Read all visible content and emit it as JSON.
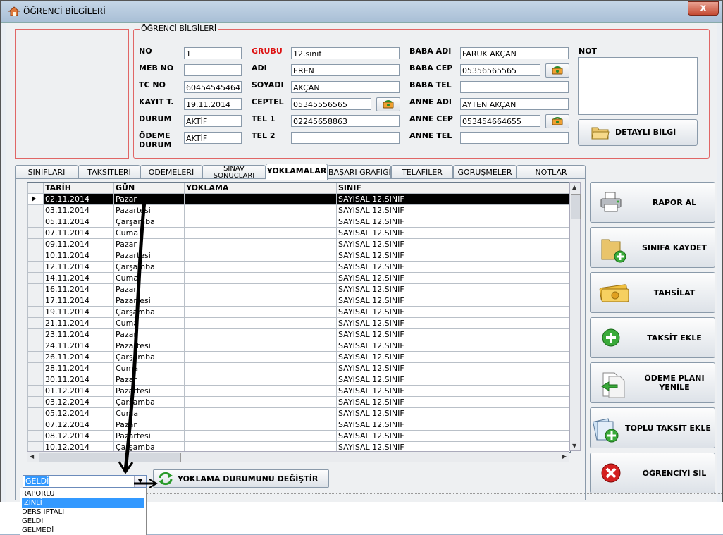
{
  "window": {
    "title": "ÖĞRENCİ BİLGİLERİ",
    "close_label": "x"
  },
  "student": {
    "group_title": "ÖĞRENCİ BİLGİLERİ",
    "labels": {
      "no": "NO",
      "meb_no": "MEB NO",
      "tc_no": "TC NO",
      "kayit": "KAYIT T.",
      "durum": "DURUM",
      "odeme_durum_1": "ÖDEME",
      "odeme_durum_2": "DURUM",
      "grubu": "GRUBU",
      "adi": "ADI",
      "soyadi": "SOYADI",
      "ceptel": "CEPTEL",
      "tel1": "TEL 1",
      "tel2": "TEL 2",
      "baba_adi": "BABA ADI",
      "baba_cep": "BABA CEP",
      "baba_tel": "BABA TEL",
      "anne_adi": "ANNE ADI",
      "anne_cep": "ANNE CEP",
      "anne_tel": "ANNE TEL",
      "not": "NOT"
    },
    "values": {
      "no": "1",
      "meb_no": "",
      "tc_no": "60454545464",
      "kayit": "19.11.2014",
      "durum": "AKTİF",
      "odeme_durum": "AKTİF",
      "grubu": "12.sınıf",
      "adi": "EREN",
      "soyadi": "AKÇAN",
      "ceptel": "05345556565",
      "tel1": "02245658863",
      "tel2": "",
      "baba_adi": "FARUK AKÇAN",
      "baba_cep": "05356565565",
      "baba_tel": "",
      "anne_adi": "AYTEN AKÇAN",
      "anne_cep": "053454664655",
      "anne_tel": "",
      "not": ""
    },
    "detay_button": "DETAYLI BİLGİ"
  },
  "tabs": [
    {
      "label": "SINIFLARI"
    },
    {
      "label": "TAKSİTLERİ"
    },
    {
      "label": "ÖDEMELERİ"
    },
    {
      "label_1": "SINAV",
      "label_2": "SONUÇLARI"
    },
    {
      "label": "YOKLAMALAR"
    },
    {
      "label": "BAŞARI GRAFİĞİ"
    },
    {
      "label": "TELAFİLER"
    },
    {
      "label": "GÖRÜŞMELER"
    },
    {
      "label": "NOTLAR"
    }
  ],
  "attendance": {
    "columns": [
      "TARİH",
      "GÜN",
      "YOKLAMA",
      "SINIF"
    ],
    "rows": [
      [
        "02.11.2014",
        "Pazar",
        "",
        "SAYISAL 12.SINIF"
      ],
      [
        "03.11.2014",
        "Pazartesi",
        "",
        "SAYISAL 12.SINIF"
      ],
      [
        "05.11.2014",
        "Çarşamba",
        "",
        "SAYISAL 12.SINIF"
      ],
      [
        "07.11.2014",
        "Cuma",
        "",
        "SAYISAL 12.SINIF"
      ],
      [
        "09.11.2014",
        "Pazar",
        "",
        "SAYISAL 12.SINIF"
      ],
      [
        "10.11.2014",
        "Pazartesi",
        "",
        "SAYISAL 12.SINIF"
      ],
      [
        "12.11.2014",
        "Çarşamba",
        "",
        "SAYISAL 12.SINIF"
      ],
      [
        "14.11.2014",
        "Cuma",
        "",
        "SAYISAL 12.SINIF"
      ],
      [
        "16.11.2014",
        "Pazar",
        "",
        "SAYISAL 12.SINIF"
      ],
      [
        "17.11.2014",
        "Pazartesi",
        "",
        "SAYISAL 12.SINIF"
      ],
      [
        "19.11.2014",
        "Çarşamba",
        "",
        "SAYISAL 12.SINIF"
      ],
      [
        "21.11.2014",
        "Cuma",
        "",
        "SAYISAL 12.SINIF"
      ],
      [
        "23.11.2014",
        "Pazar",
        "",
        "SAYISAL 12.SINIF"
      ],
      [
        "24.11.2014",
        "Pazartesi",
        "",
        "SAYISAL 12.SINIF"
      ],
      [
        "26.11.2014",
        "Çarşamba",
        "",
        "SAYISAL 12.SINIF"
      ],
      [
        "28.11.2014",
        "Cuma",
        "",
        "SAYISAL 12.SINIF"
      ],
      [
        "30.11.2014",
        "Pazar",
        "",
        "SAYISAL 12.SINIF"
      ],
      [
        "01.12.2014",
        "Pazartesi",
        "",
        "SAYISAL 12.SINIF"
      ],
      [
        "03.12.2014",
        "Çarşamba",
        "",
        "SAYISAL 12.SINIF"
      ],
      [
        "05.12.2014",
        "Cuma",
        "",
        "SAYISAL 12.SINIF"
      ],
      [
        "07.12.2014",
        "Pazar",
        "",
        "SAYISAL 12.SINIF"
      ],
      [
        "08.12.2014",
        "Pazartesi",
        "",
        "SAYISAL 12.SINIF"
      ],
      [
        "10.12.2014",
        "Çarşamba",
        "",
        "SAYISAL 12.SINIF"
      ]
    ]
  },
  "attendance_control": {
    "selected": "GELDİ",
    "change_button": "YOKLAMA DURUMUNU DEĞİŞTİR",
    "options": [
      "RAPORLU",
      "İZİNLİ",
      "DERS İPTALİ",
      "GELDİ",
      "GELMEDİ"
    ],
    "highlighted_option": "İZİNLİ"
  },
  "side_buttons": [
    {
      "label": "RAPOR AL",
      "icon": "printer-icon"
    },
    {
      "label": "SINIFA KAYDET",
      "icon": "folder-add-icon"
    },
    {
      "label": "TAHSİLAT",
      "icon": "money-icon"
    },
    {
      "label": "TAKSİT EKLE",
      "icon": "add-icon"
    },
    {
      "label": "ÖDEME PLANI YENİLE",
      "icon": "document-refresh-icon"
    },
    {
      "label": "TOPLU TAKSİT EKLE",
      "icon": "bulk-add-icon"
    },
    {
      "label": "ÖĞRENCİYİ SİL",
      "icon": "delete-icon"
    }
  ]
}
